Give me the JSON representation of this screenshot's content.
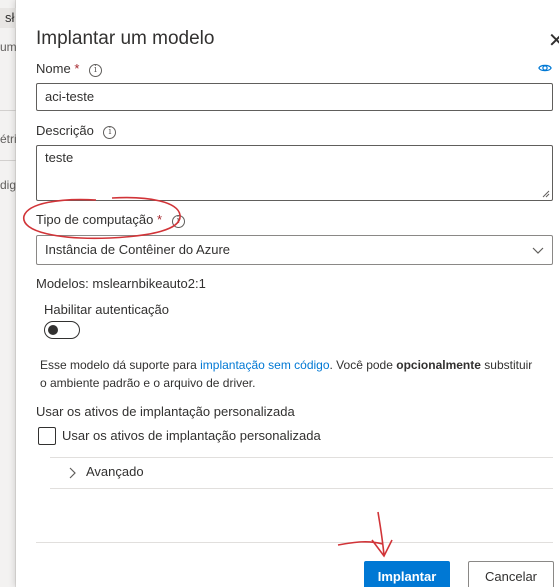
{
  "background": {
    "tab_fragment": "sł",
    "fragments": [
      "um",
      "étri",
      "dig"
    ]
  },
  "dialog": {
    "title": "Implantar um modelo",
    "close_glyph": "✕",
    "name": {
      "label": "Nome",
      "required_mark": "*",
      "value": "aci-teste"
    },
    "description": {
      "label": "Descrição",
      "value": "teste"
    },
    "compute_type": {
      "label": "Tipo de computação",
      "required_mark": "*",
      "selected": "Instância de Contêiner do Azure"
    },
    "models_line": "Modelos: mslearnbikeauto2:1",
    "auth": {
      "label": "Habilitar autenticação",
      "enabled": false
    },
    "info_text": {
      "part1": "Esse modelo dá suporte para ",
      "link": "implantação sem código",
      "part2": ". Você pode ",
      "bold": "opcionalmente",
      "part3": " substituir o ambiente padrão e o arquivo de driver."
    },
    "custom_assets": {
      "heading": "Usar os ativos de implantação personalizada",
      "checkbox_label": "Usar os ativos de implantação personalizada",
      "checked": false
    },
    "advanced_label": "Avançado",
    "buttons": {
      "deploy": "Implantar",
      "cancel": "Cancelar"
    }
  },
  "colors": {
    "accent": "#0078d4",
    "required": "#a4262c",
    "annotation": "#d13438"
  }
}
